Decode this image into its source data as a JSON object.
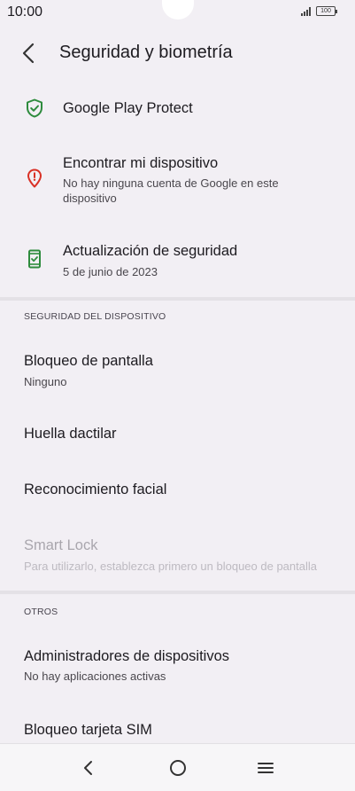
{
  "status_bar": {
    "time": "10:00",
    "battery": "100"
  },
  "header": {
    "title": "Seguridad y biometría"
  },
  "items": [
    {
      "title": "Google Play Protect",
      "icon": "shield-check-icon",
      "color": "#2e8b3d"
    },
    {
      "title": "Encontrar mi dispositivo",
      "subtitle": "No hay ninguna cuenta de Google en este dispositivo",
      "icon": "location-alert-icon",
      "color": "#d93025"
    },
    {
      "title": "Actualización de seguridad",
      "subtitle": "5 de junio de 2023",
      "icon": "security-update-icon",
      "color": "#2e8b3d"
    }
  ],
  "sections": {
    "device_security": {
      "header": "SEGURIDAD DEL DISPOSITIVO",
      "items": [
        {
          "title": "Bloqueo de pantalla",
          "subtitle": "Ninguno"
        },
        {
          "title": "Huella dactilar"
        },
        {
          "title": "Reconocimiento facial"
        },
        {
          "title": "Smart Lock",
          "subtitle": "Para utilizarlo, establezca primero un bloqueo de pantalla",
          "disabled": true
        }
      ]
    },
    "others": {
      "header": "OTROS",
      "items": [
        {
          "title": "Administradores de dispositivos",
          "subtitle": "No hay aplicaciones activas"
        },
        {
          "title": "Bloqueo tarjeta SIM"
        }
      ]
    }
  },
  "nav": {
    "back": "back-icon",
    "home": "home-icon",
    "recents": "menu-icon"
  }
}
